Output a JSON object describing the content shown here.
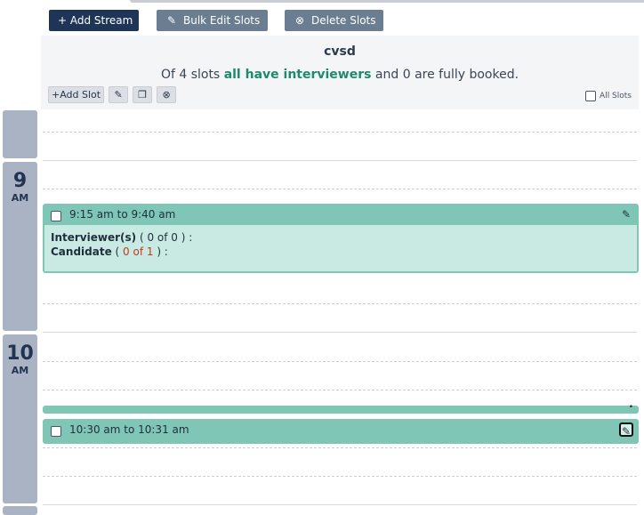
{
  "toolbar": {
    "add_stream": "+ Add Stream",
    "bulk_edit": "Bulk Edit Slots",
    "delete_slots": "Delete Slots"
  },
  "stream": {
    "name": "cvsd",
    "summary_prefix": "Of 4 slots ",
    "summary_highlight": "all have interviewers",
    "summary_suffix": " and 0 are fully booked.",
    "add_slot": "+Add Slot",
    "all_slots_label": "All Slots"
  },
  "hours": [
    {
      "num": "9",
      "ampm": "AM"
    },
    {
      "num": "10",
      "ampm": "AM"
    }
  ],
  "slots": [
    {
      "time": "9:15 am to 9:40 am",
      "interviewers_label": "Interviewer(s)",
      "interviewers_count": " ( 0 of 0 ) :",
      "candidate_label": "Candidate",
      "candidate_open": " ( ",
      "candidate_count": "0 of 1",
      "candidate_close": " ) :"
    },
    {
      "time": "10:30 am to 10:31 am"
    }
  ],
  "colors": {
    "primary": "#1f3558",
    "accent_green": "#1f8a6b",
    "slot_bg": "#7fc6b6",
    "hour_bg": "#a9b3c4"
  }
}
